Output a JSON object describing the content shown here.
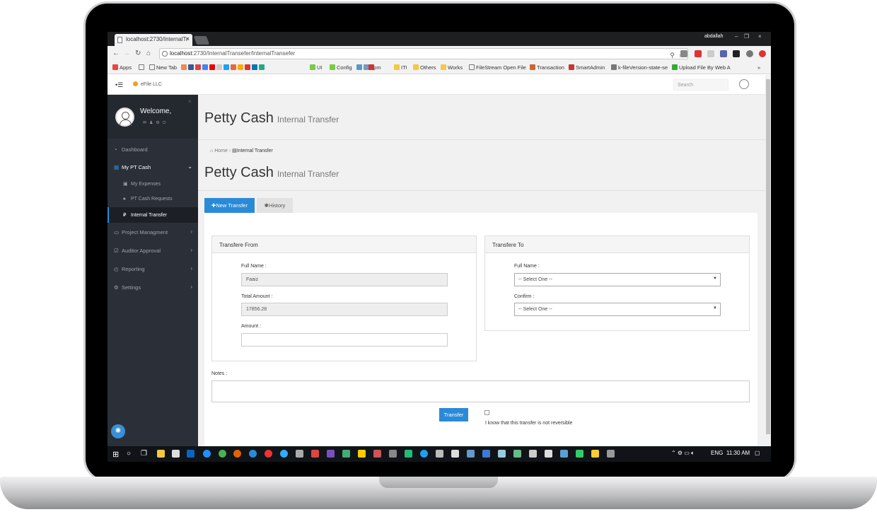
{
  "browser": {
    "tab_title": "localhost:2730/InternalTr",
    "window_user": "abdallah",
    "url_host": "localhost",
    "url_path": ":2730/InternalTransefer/InternalTransefer",
    "bookmarks": [
      "Apps",
      "New Tab",
      "UI",
      "Config",
      "npm",
      "ITI",
      "Others",
      "Works",
      "FileStream Open File",
      "Transaction",
      "SmartAdmin",
      "k-fileVersion-state-se",
      "Upload File By Web A"
    ],
    "more": "»"
  },
  "app": {
    "brand": "eFile LLC",
    "search_placeholder": "Search"
  },
  "sidebar": {
    "welcome": "Welcome,",
    "items": [
      {
        "label": "Dashboard"
      },
      {
        "label": "My PT Cash"
      },
      {
        "label": "My Expenses"
      },
      {
        "label": "PT Cash Requests"
      },
      {
        "label": "Internal Transfer"
      },
      {
        "label": "Project Managment"
      },
      {
        "label": "Auditor Approval"
      },
      {
        "label": "Reporting"
      },
      {
        "label": "Settings"
      }
    ]
  },
  "page": {
    "title": "Petty Cash",
    "subtitle": "Internal Transfer",
    "breadcrumb_home": "Home",
    "breadcrumb_current": "Internal Transfer",
    "tab_new": "New Transfer",
    "tab_history": "History"
  },
  "form": {
    "from_header": "Transfere From",
    "to_header": "Transfere To",
    "full_name_label": "Full Name :",
    "full_name_value": "Faaiz",
    "total_amount_label": "Total Amount :",
    "total_amount_value": "17856.28",
    "amount_label": "Amount :",
    "amount_value": "",
    "to_full_name_label": "Full Name :",
    "to_full_name_value": "-- Select One --",
    "confirm_label": "Confirm :",
    "confirm_value": "-- Select One --",
    "notes_label": "Notes :",
    "submit_label": "Transfer",
    "ack_label": "I know that this transfer is not reversible"
  },
  "taskbar": {
    "lang": "ENG",
    "time": "11:30 AM"
  },
  "colors": {
    "accent": "#2a8ad8",
    "sidebar_bg": "#2b3038",
    "taskbar_bg": "#101418"
  }
}
